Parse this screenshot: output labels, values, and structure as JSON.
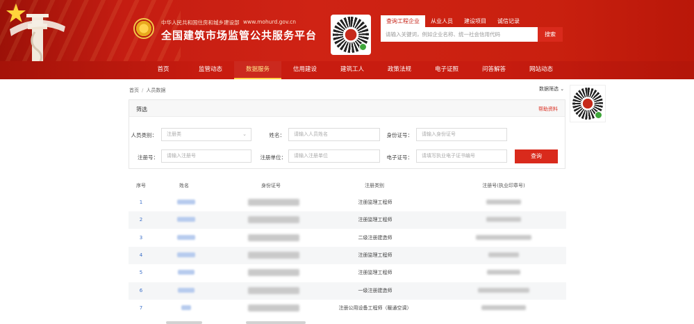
{
  "header": {
    "subtitle": "中华人民共和国住房和城乡建设部",
    "url": "www.mohurd.gov.cn",
    "title": "全国建筑市场监管公共服务平台",
    "search_tabs": [
      "查询工程企业",
      "从业人员",
      "建设项目",
      "诚信记录"
    ],
    "search_placeholder": "请输入关键词，例如企业名称、统一社会信用代码",
    "search_button": "搜索"
  },
  "nav": {
    "items": [
      "首页",
      "监管动态",
      "数据服务",
      "信用建设",
      "建筑工人",
      "政策法规",
      "电子证照",
      "问答解答",
      "网站动态"
    ],
    "active_index": 2
  },
  "breadcrumb": [
    "首页",
    "人员数据"
  ],
  "data_select": "数据筛选",
  "panel": {
    "title": "筛选",
    "link": "帮助资料"
  },
  "filters": {
    "person_type_label": "人员类别：",
    "person_type_value": "注册类",
    "name_label": "姓名：",
    "name_placeholder": "请输入人员姓名",
    "id_label": "身份证号：",
    "id_placeholder": "请输入身份证号",
    "reg_no_label": "注册号：",
    "reg_no_placeholder": "请输入注册号",
    "reg_unit_label": "注册单位：",
    "reg_unit_placeholder": "请输入注册单位",
    "cert_label": "电子证号：",
    "cert_placeholder": "请填写执业电子证书编号",
    "query_button": "查询"
  },
  "table": {
    "headers": [
      "序号",
      "姓名",
      "身份证号",
      "注册类别",
      "注册号(执业印章号)"
    ],
    "rows": [
      {
        "index": "1",
        "category": "注册监理工程师"
      },
      {
        "index": "2",
        "category": "注册监理工程师"
      },
      {
        "index": "3",
        "category": "二级注册建造师"
      },
      {
        "index": "4",
        "category": "注册监理工程师"
      },
      {
        "index": "5",
        "category": "注册监理工程师"
      },
      {
        "index": "6",
        "category": "一级注册建造师"
      },
      {
        "index": "7",
        "category": "注册公用设备工程师（暖通空调）"
      }
    ]
  },
  "colors": {
    "brand_red": "#c51d12",
    "button_red": "#d92a1c",
    "nav_active": "#ffd24a",
    "index_blue": "#3a6ec8"
  }
}
